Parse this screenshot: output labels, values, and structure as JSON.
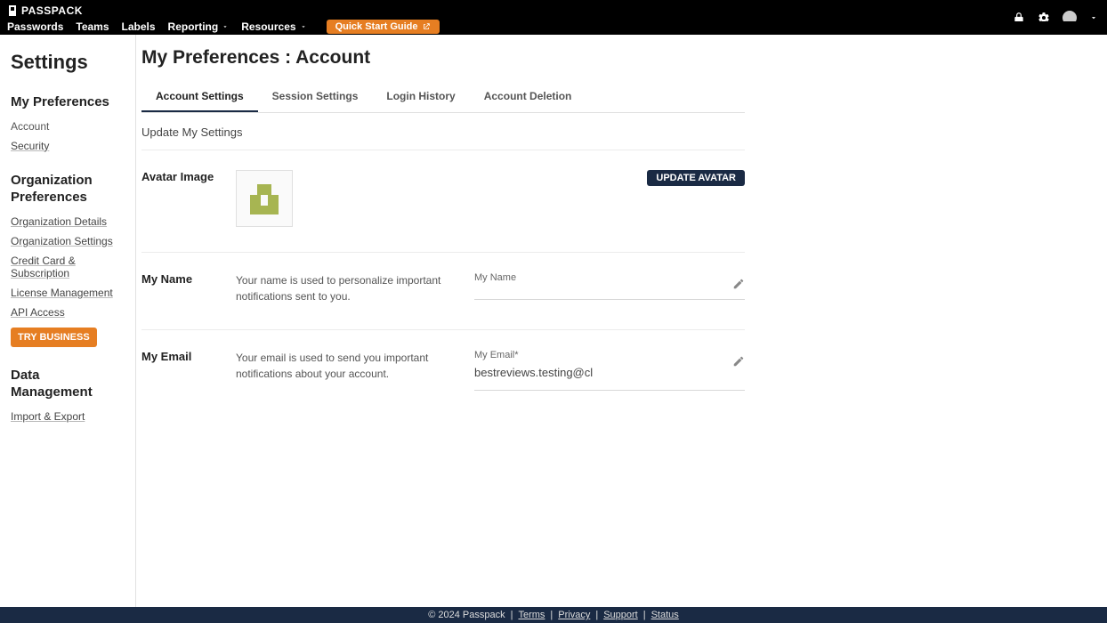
{
  "brand": "PASSPACK",
  "nav": {
    "passwords": "Passwords",
    "teams": "Teams",
    "labels": "Labels",
    "reporting": "Reporting",
    "resources": "Resources",
    "quick_start": "Quick Start Guide"
  },
  "sidebar": {
    "title": "Settings",
    "my_prefs": {
      "title": "My Preferences",
      "account": "Account",
      "security": "Security"
    },
    "org_prefs": {
      "title": "Organization Preferences",
      "org_details": "Organization Details",
      "org_settings": "Organization Settings",
      "credit_card": "Credit Card & Subscription",
      "license_mgmt": "License Management",
      "api_access": "API Access",
      "try_business": "TRY BUSINESS"
    },
    "data_mgmt": {
      "title": "Data Management",
      "import_export": "Import & Export"
    }
  },
  "page": {
    "title": "My Preferences : Account",
    "tabs": {
      "account_settings": "Account Settings",
      "session_settings": "Session Settings",
      "login_history": "Login History",
      "account_deletion": "Account Deletion"
    },
    "update_label": "Update My Settings",
    "avatar": {
      "label": "Avatar Image",
      "button": "UPDATE AVATAR"
    },
    "name": {
      "label": "My Name",
      "desc": "Your name is used to personalize important notifications sent to you.",
      "field_label": "My Name",
      "field_value": ""
    },
    "email": {
      "label": "My Email",
      "desc": "Your email is used to send you important notifications about your account.",
      "field_label": "My Email*",
      "field_value": "bestreviews.testing@cl"
    }
  },
  "footer": {
    "copyright": "© 2024 Passpack",
    "sep": "|",
    "terms": "Terms",
    "privacy": "Privacy",
    "support": "Support",
    "status": "Status"
  }
}
